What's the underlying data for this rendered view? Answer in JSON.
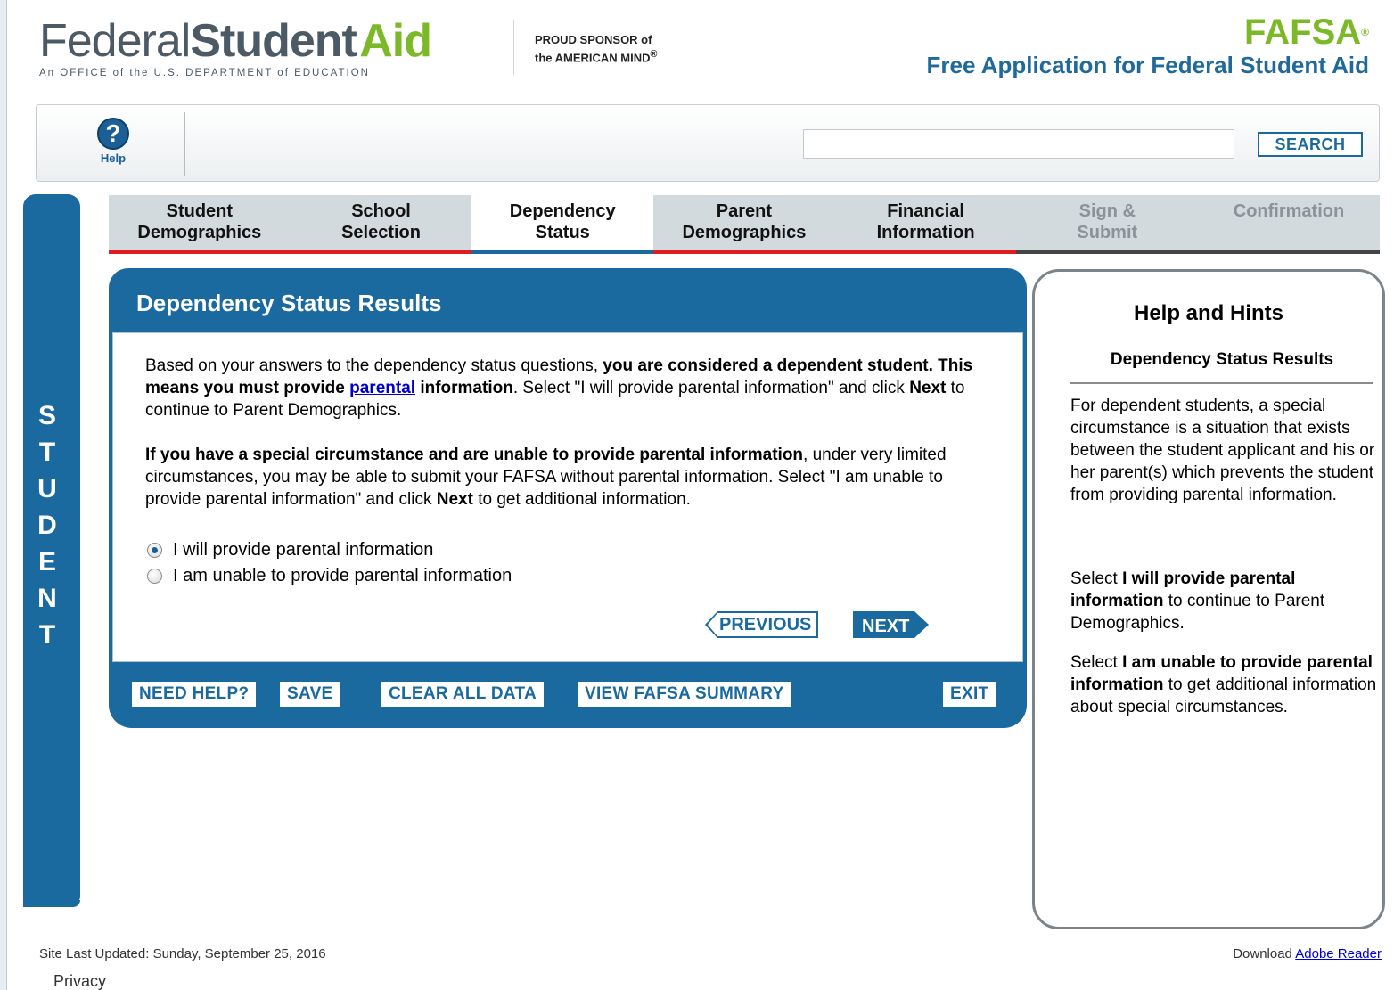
{
  "header": {
    "brand_part1": "Federal",
    "brand_part2": "Student",
    "brand_part3": "Aid",
    "brand_subtitle": "An OFFICE of the U.S. DEPARTMENT of EDUCATION",
    "sponsor_line1": "PROUD SPONSOR of",
    "sponsor_line2": "the AMERICAN MIND",
    "sponsor_mark": "®",
    "fafsa_logo": "FAFSA",
    "fafsa_mark": "®",
    "fafsa_full": "Free Application for Federal Student Aid"
  },
  "toolbar": {
    "help_icon_glyph": "?",
    "help_label": "Help",
    "search_value": "",
    "search_button": "SEARCH"
  },
  "side_tab": {
    "letters": [
      "S",
      "T",
      "U",
      "D",
      "E",
      "N",
      "T"
    ]
  },
  "steps": [
    {
      "line1": "Student",
      "line2": "Demographics",
      "state": "done"
    },
    {
      "line1": "School",
      "line2": "Selection",
      "state": "done"
    },
    {
      "line1": "Dependency",
      "line2": "Status",
      "state": "current"
    },
    {
      "line1": "Parent",
      "line2": "Demographics",
      "state": "done"
    },
    {
      "line1": "Financial",
      "line2": "Information",
      "state": "done"
    },
    {
      "line1": "Sign &",
      "line2": "Submit",
      "state": "disabled"
    },
    {
      "line1": "Confirmation",
      "line2": "",
      "state": "disabled"
    }
  ],
  "main": {
    "title": "Dependency Status Results",
    "p1_a": "Based on your answers to the dependency status questions, ",
    "p1_b": "you are considered a dependent student. This means you must provide ",
    "p1_link": "parental",
    "p1_c": " information",
    "p1_d": ". Select \"I will provide parental information\" and click ",
    "p1_e": "Next",
    "p1_f": " to continue to Parent Demographics.",
    "p2_a": "If you have a special circumstance and are unable to provide parental information",
    "p2_b": ", under very limited circumstances, you may be able to submit your FAFSA without parental information. Select \"I am unable to provide parental information\" and click ",
    "p2_c": "Next",
    "p2_d": " to get additional information.",
    "option1": "I will provide parental information",
    "option2": "I am unable to provide parental information",
    "selected_option": 1,
    "previous": "PREVIOUS",
    "next": "NEXT"
  },
  "footer_actions": {
    "need_help": "NEED HELP?",
    "save": "SAVE",
    "clear": "CLEAR ALL DATA",
    "summary": "VIEW FAFSA SUMMARY",
    "exit": "EXIT"
  },
  "hints": {
    "title": "Help and Hints",
    "subtitle": "Dependency Status Results",
    "p1": "For dependent students, a special circumstance is a situation that exists between the student applicant and his or her parent(s) which prevents the student from providing parental information.",
    "p2_a": "Select ",
    "p2_b": "I will provide parental information",
    "p2_c": " to continue to Parent Demographics.",
    "p3_a": "Select ",
    "p3_b": "I am unable to provide parental information",
    "p3_c": " to get additional information about special circumstances."
  },
  "page_footer": {
    "updated": "Site Last Updated: Sunday, September 25, 2016",
    "download_prefix": "Download ",
    "download_link": "Adobe Reader",
    "privacy": "Privacy"
  },
  "colors": {
    "brand_blue": "#1a6aa0",
    "brand_green": "#7bb928",
    "step_done_red": "#e01b23"
  }
}
